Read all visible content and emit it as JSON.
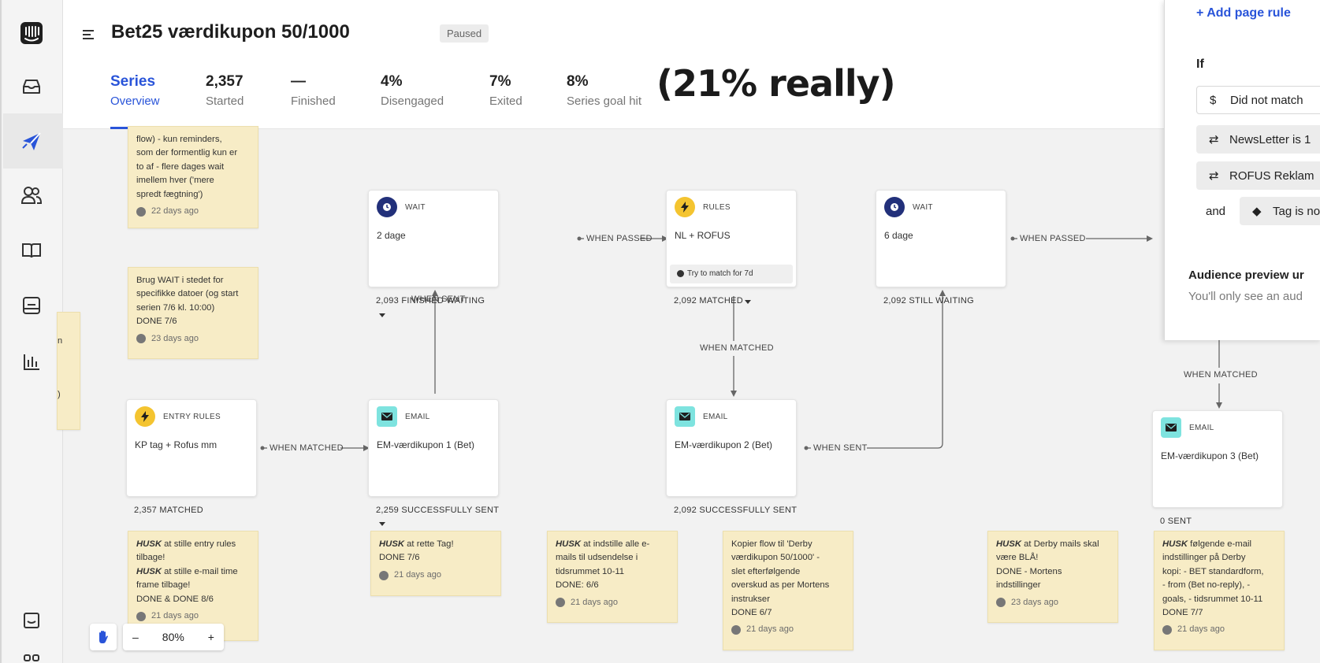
{
  "header": {
    "title": "Bet25 værdikupon 50/1000",
    "status": "Paused",
    "stats": [
      {
        "value": "Series",
        "label": "Overview"
      },
      {
        "value": "2,357",
        "label": "Started"
      },
      {
        "value": "—",
        "label": "Finished"
      },
      {
        "value": "4%",
        "label": "Disengaged"
      },
      {
        "value": "7%",
        "label": "Exited"
      },
      {
        "value": "8%",
        "label": "Series goal hit"
      }
    ],
    "annotation": "(21% really)"
  },
  "nav": {
    "icons": [
      "intercom-logo-icon",
      "inbox-icon",
      "outbound-send-icon",
      "contacts-icon",
      "knowledge-book-icon",
      "messenger-icon",
      "reports-chart-icon",
      "feedback-icon",
      "apps-icon"
    ]
  },
  "nodes": {
    "wait1": {
      "type": "WAIT",
      "name": "2 dage",
      "count": "2,093 FINISHED WAITING"
    },
    "rules1": {
      "type": "RULES",
      "name": "NL + ROFUS",
      "try": "Try to match for 7d",
      "count": "2,092 MATCHED"
    },
    "wait2": {
      "type": "WAIT",
      "name": "6 dage",
      "count": "2,092 STILL WAITING"
    },
    "entry": {
      "type": "ENTRY RULES",
      "name": "KP tag + Rofus mm",
      "count": "2,357 MATCHED"
    },
    "email1": {
      "type": "EMAIL",
      "name": "EM-værdikupon 1 (Bet)",
      "count": "2,259 SUCCESSFULLY SENT"
    },
    "email2": {
      "type": "EMAIL",
      "name": "EM-værdikupon 2 (Bet)",
      "count": "2,092 SUCCESSFULLY SENT"
    },
    "email3": {
      "type": "EMAIL",
      "name": "EM-værdikupon 3 (Bet)",
      "count": "0 SENT"
    }
  },
  "connectors": {
    "when_passed_1": "WHEN PASSED",
    "when_passed_2": "WHEN PASSED",
    "when_sent_up": "WHEN SENT",
    "when_matched_down": "WHEN MATCHED",
    "when_matched_entry": "WHEN MATCHED",
    "when_sent_2": "WHEN SENT",
    "when_matched_right": "WHEN MATCHED"
  },
  "notes": {
    "n1": {
      "text": "flow) - kun reminders,\nsom der formentlig kun er\nto af - flere dages wait\nimellem hver ('mere\nspredt fægtning')",
      "age": "22 days ago"
    },
    "n2": {
      "text": "Brug WAIT i stedet for\nspecifikke datoer (og start\nserien 7/6 kl. 10:00)\nDONE 7/6",
      "age": "23 days ago"
    },
    "n3": {
      "bold1": "HUSK",
      "text1": " at stille entry rules\ntilbage!",
      "bold2": "HUSK",
      "text2": " at stille e-mail time\nframe tilbage!\nDONE & DONE 8/6",
      "age": "21 days ago"
    },
    "n4": {
      "bold": "HUSK",
      "text": " at rette Tag!\nDONE 7/6",
      "age": "21 days ago"
    },
    "n5": {
      "bold": "HUSK",
      "text": " at indstille alle e-\nmails til udsendelse i\ntidsrummet 10-11\nDONE: 6/6",
      "age": "21 days ago"
    },
    "n6": {
      "text": "Kopier flow til 'Derby\nværdikupon 50/1000' -\nslet efterfølgende\noverskud as per Mortens\ninstrukser\nDONE 6/7",
      "age": "21 days ago"
    },
    "n7": {
      "bold": "HUSK",
      "text": " at Derby mails skal\nvære BLÅ!\nDONE - Mortens\nindstillinger",
      "age": "23 days ago"
    },
    "n8": {
      "bold": "HUSK",
      "text": " følgende e-mail\nindstillinger på Derby\nkopi: - BET standardform,\n- from (Bet no-reply), -\ngoals, - tidsrummet 10-11\nDONE 7/7",
      "age": "21 days ago"
    },
    "edge_left": {
      "line1": "n",
      "line2": ")"
    }
  },
  "panel": {
    "add_rule": "+ Add page rule",
    "if_label": "If",
    "rules": [
      "Did not match",
      "NewsLetter is 1",
      "ROFUS Reklam",
      "Tag is no"
    ],
    "and_label": "and",
    "preview_title": "Audience preview ur",
    "preview_sub": "You'll only see an aud"
  },
  "zoom": {
    "level": "80%",
    "minus": "–",
    "plus": "+"
  }
}
